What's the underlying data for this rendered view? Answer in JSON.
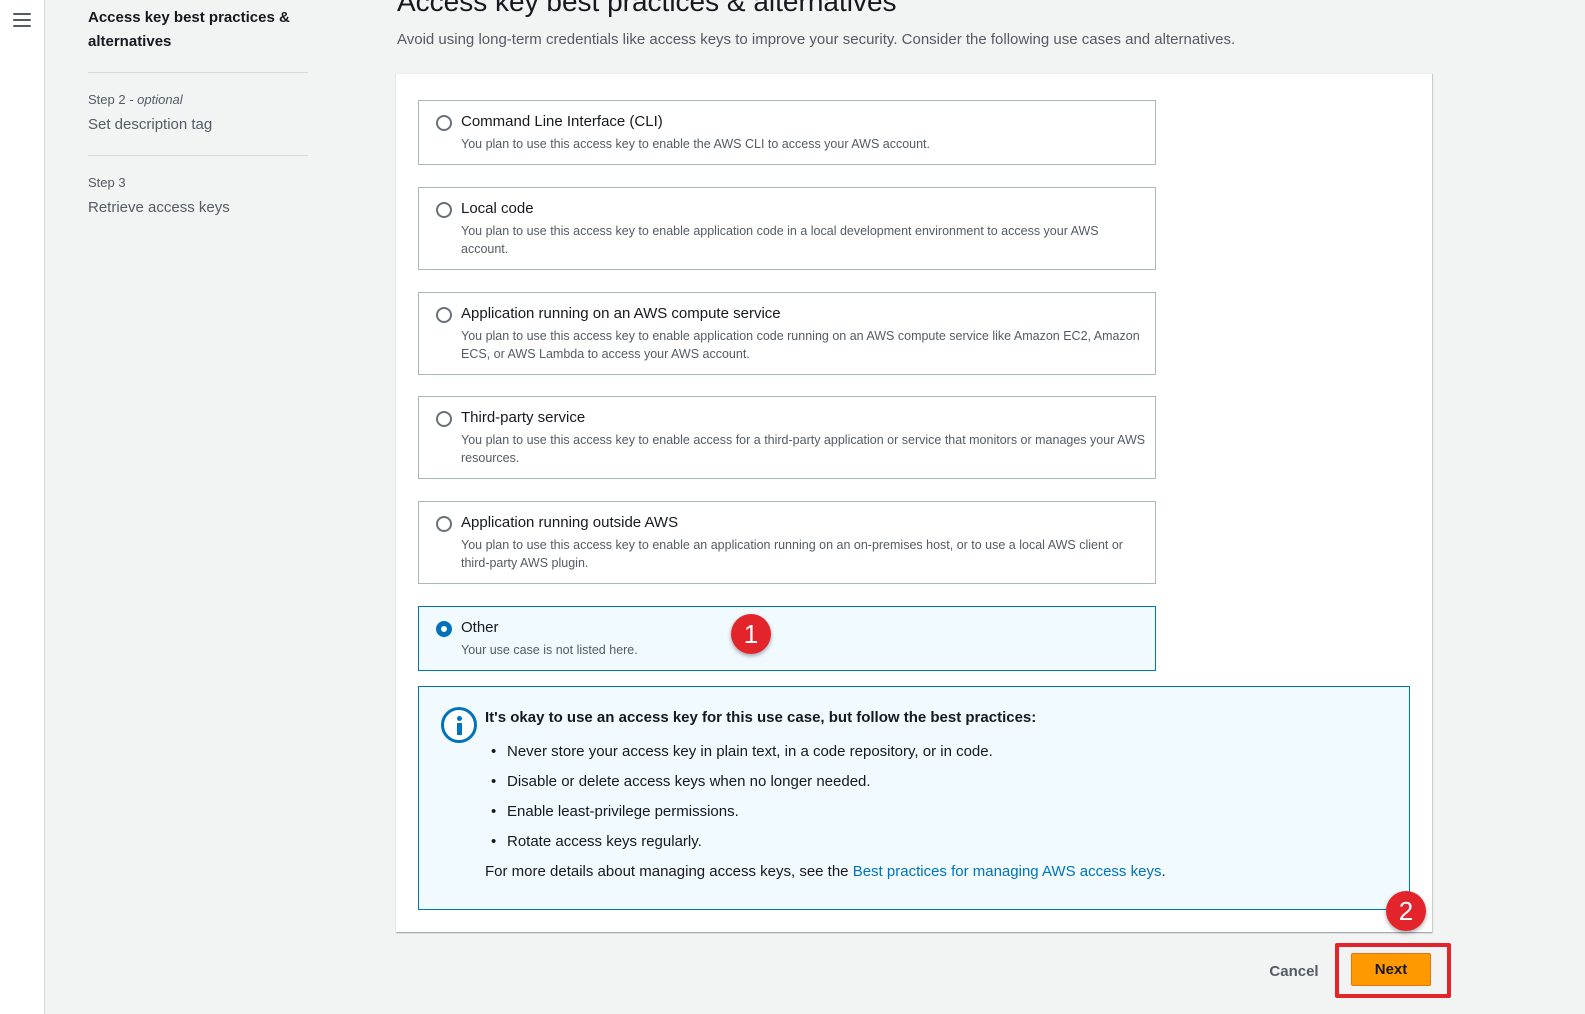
{
  "steps": [
    {
      "title": "Access key best practices & alternatives"
    },
    {
      "label_prefix": "Step 2 - ",
      "label_optional": "optional",
      "title": "Set description tag"
    },
    {
      "label": "Step 3",
      "title": "Retrieve access keys"
    }
  ],
  "header": {
    "title": "Access key best practices & alternatives",
    "description": "Avoid using long-term credentials like access keys to improve your security. Consider the following use cases and alternatives."
  },
  "options": [
    {
      "title": "Command Line Interface (CLI)",
      "desc": "You plan to use this access key to enable the AWS CLI to access your AWS account.",
      "selected": false
    },
    {
      "title": "Local code",
      "desc": "You plan to use this access key to enable application code in a local development environment to access your AWS account.",
      "selected": false
    },
    {
      "title": "Application running on an AWS compute service",
      "desc": "You plan to use this access key to enable application code running on an AWS compute service like Amazon EC2, Amazon ECS, or AWS Lambda to access your AWS account.",
      "selected": false
    },
    {
      "title": "Third-party service",
      "desc": "You plan to use this access key to enable access for a third-party application or service that monitors or manages your AWS resources.",
      "selected": false
    },
    {
      "title": "Application running outside AWS",
      "desc": "You plan to use this access key to enable an application running on an on-premises host, or to use a local AWS client or third-party AWS plugin.",
      "selected": false
    },
    {
      "title": "Other",
      "desc": "Your use case is not listed here.",
      "selected": true
    }
  ],
  "alert": {
    "title": "It's okay to use an access key for this use case, but follow the best practices:",
    "items": [
      "Never store your access key in plain text, in a code repository, or in code.",
      "Disable or delete access keys when no longer needed.",
      "Enable least-privilege permissions.",
      "Rotate access keys regularly."
    ],
    "footer_prefix": "For more details about managing access keys, see the ",
    "footer_link": "Best practices for managing AWS access keys",
    "footer_suffix": "."
  },
  "actions": {
    "cancel": "Cancel",
    "next": "Next"
  },
  "annotations": {
    "badge1": "1",
    "badge2": "2"
  },
  "colors": {
    "accent": "#0073bb",
    "primary_button": "#ff9900",
    "annotation_red": "#e3242b"
  }
}
